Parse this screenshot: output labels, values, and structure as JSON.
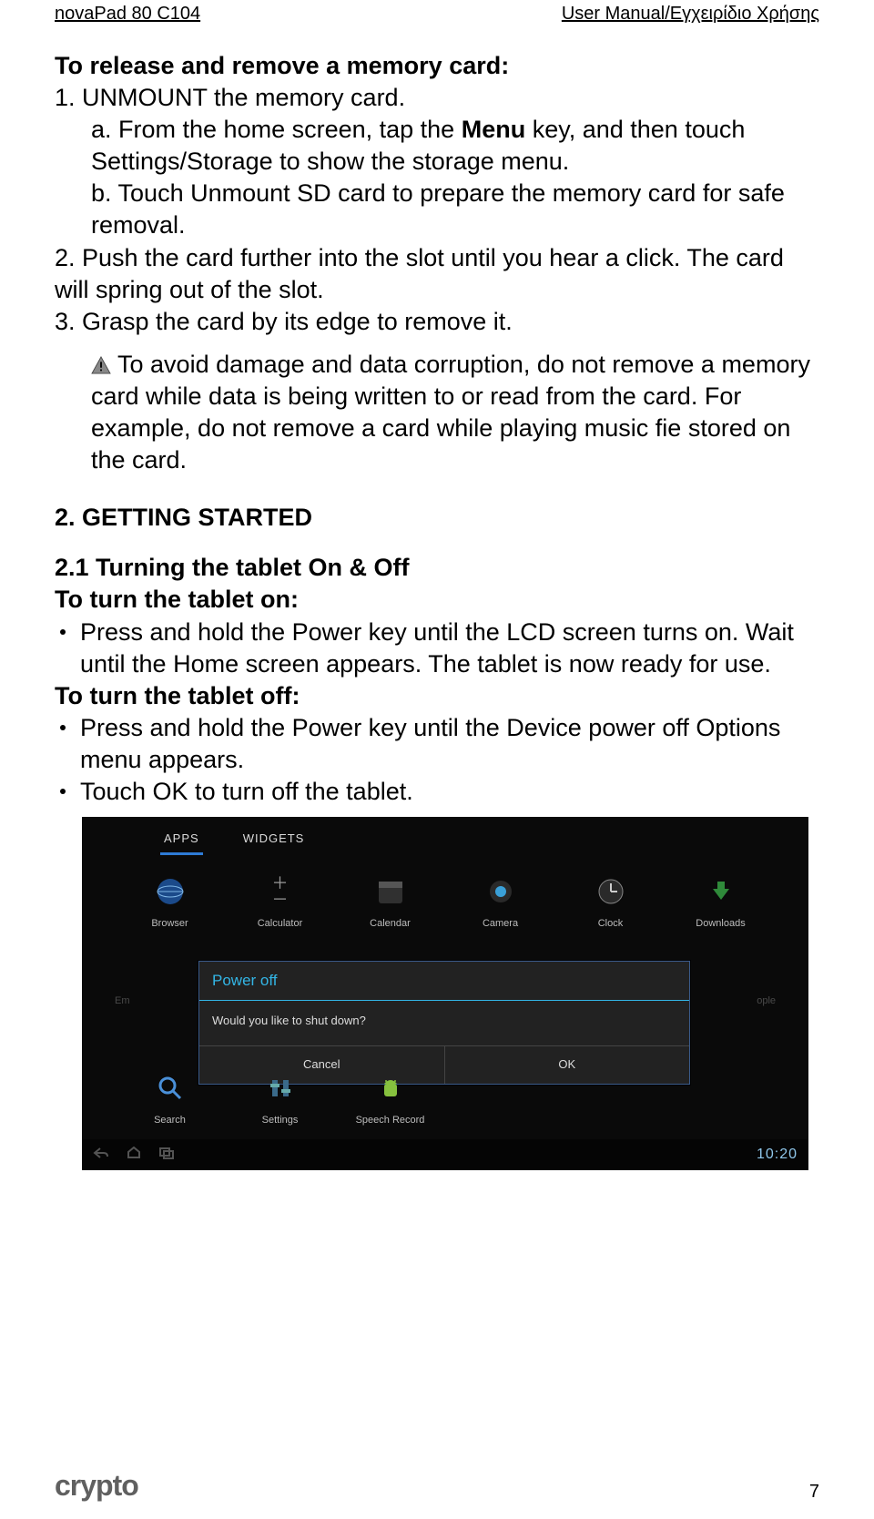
{
  "header": {
    "left": "novaPad 80 C104",
    "right": "User Manual/Εγχειρίδιο Χρήσης"
  },
  "h1": "To release and remove a memory card:",
  "step1": "1. UNMOUNT the memory card.",
  "step1a_pre": "a. From the home screen, tap the ",
  "step1a_bold": "Menu",
  "step1a_post": " key, and then touch Settings/Storage to show the storage menu.",
  "step1b": "b. Touch Unmount SD card to prepare the memory card for safe removal.",
  "step2": "2. Push the card further into the slot until you hear a click. The card will spring out of the slot.",
  "step3": "3. Grasp the card by its edge to remove it.",
  "warn": "To avoid damage and data corruption, do not remove a memory card while data is being written to or read from the card. For example, do not remove a card while playing music fie stored on the card.",
  "h2": "2. GETTING STARTED",
  "h21": "2.1 Turning the tablet On & Off",
  "on_title": "To turn the tablet on:",
  "on_b1": "Press and hold the Power key until the LCD screen turns on. Wait until the Home screen appears. The tablet is now ready for use.",
  "off_title": "To turn the tablet off:",
  "off_b1": "Press and hold the Power key until the Device power off Options menu appears.",
  "off_b2": "Touch OK to turn off the tablet.",
  "shot": {
    "tabs": {
      "apps": "APPS",
      "widgets": "WIDGETS"
    },
    "apps_row1": [
      "Browser",
      "Calculator",
      "Calendar",
      "Camera",
      "Clock",
      "Downloads"
    ],
    "apps_row2": [
      "Search",
      "Settings",
      "Speech Record"
    ],
    "partial_left": "Em",
    "partial_right": "ople",
    "dialog": {
      "title": "Power off",
      "body": "Would you like to shut down?",
      "cancel": "Cancel",
      "ok": "OK"
    },
    "clock": "10:20"
  },
  "footer": {
    "logo": "crypto",
    "page": "7"
  }
}
